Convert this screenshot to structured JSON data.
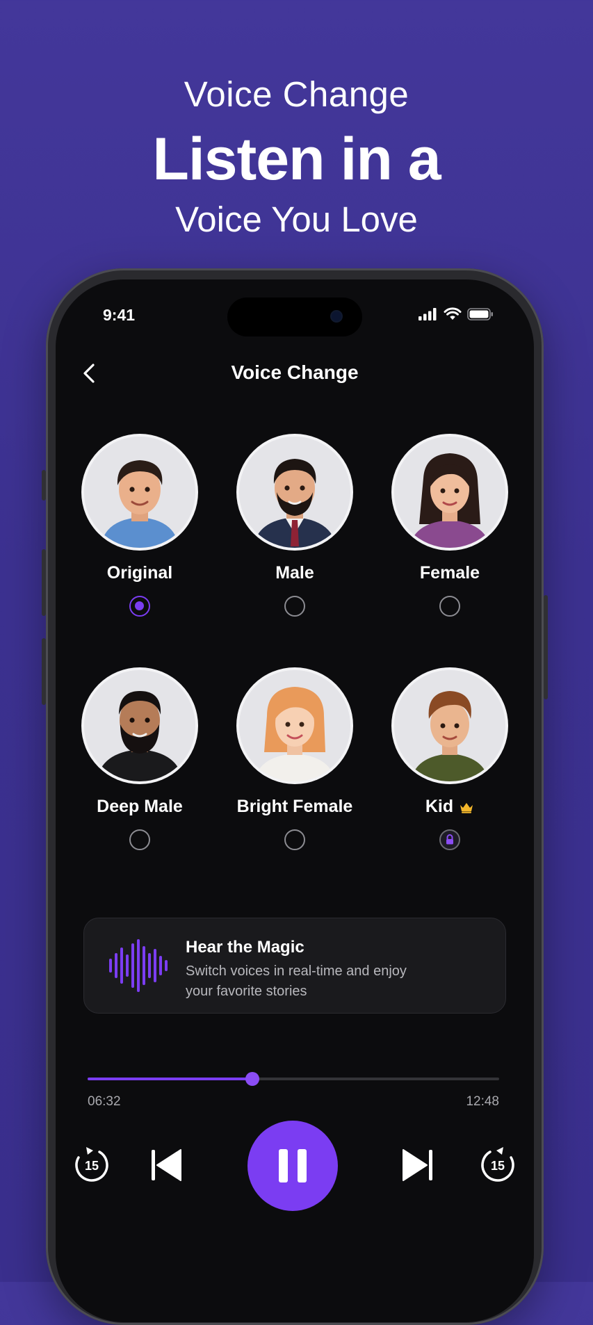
{
  "hero": {
    "line1": "Voice Change",
    "line2": "Listen in a",
    "line3": "Voice You Love"
  },
  "status_bar": {
    "time": "9:41",
    "icons": [
      "signal-icon",
      "wifi-icon",
      "battery-icon"
    ]
  },
  "nav": {
    "back_icon": "chevron-left-icon",
    "title": "Voice Change"
  },
  "voices": [
    {
      "name": "Original",
      "selected": true,
      "locked": false
    },
    {
      "name": "Male",
      "selected": false,
      "locked": false
    },
    {
      "name": "Female",
      "selected": false,
      "locked": false
    },
    {
      "name": "Deep Male",
      "selected": false,
      "locked": false
    },
    {
      "name": "Bright Female",
      "selected": false,
      "locked": false
    },
    {
      "name": "Kid",
      "selected": false,
      "locked": true,
      "premium_icon": "crown-icon"
    }
  ],
  "promo_card": {
    "icon": "sound-wave-icon",
    "title": "Hear the Magic",
    "subtitle": "Switch voices in real-time and enjoy your favorite stories"
  },
  "player": {
    "elapsed": "06:32",
    "total": "12:48",
    "progress": 0.4,
    "rewind_label": "15",
    "forward_label": "15",
    "controls": [
      "rewind-15-icon",
      "previous-track-icon",
      "pause-icon",
      "next-track-icon",
      "forward-15-icon"
    ]
  },
  "colors": {
    "accent": "#7b3df2",
    "background": "#3c3190",
    "screen": "#0c0c0e",
    "crown": "#f2b62b"
  }
}
